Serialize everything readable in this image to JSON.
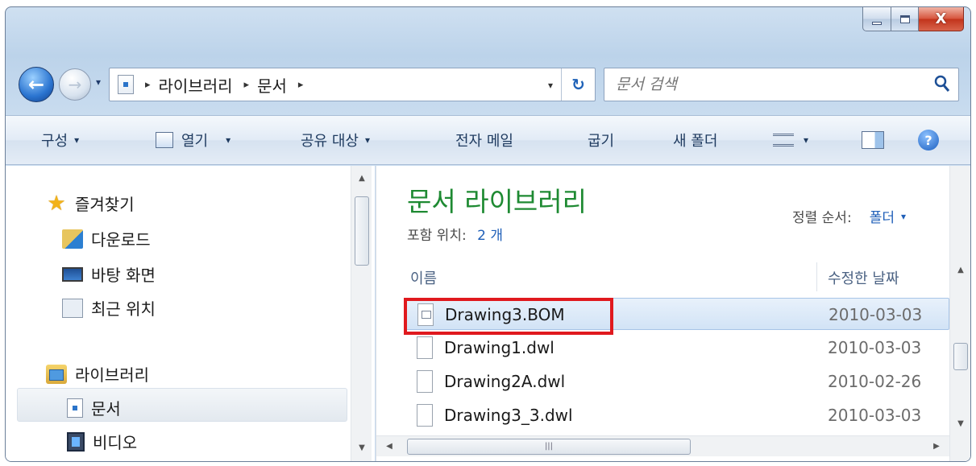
{
  "window": {
    "caption": {
      "minimize_icon": "minimize-icon",
      "maximize_icon": "maximize-icon",
      "close_glyph": "X"
    }
  },
  "address": {
    "crumbs": [
      "라이브러리",
      "문서"
    ],
    "separator": "▸",
    "dropdown": "▾",
    "refresh": "↻"
  },
  "search": {
    "placeholder": "문서 검색",
    "icon": "search-icon"
  },
  "commands": {
    "organize": "구성",
    "open": "열기",
    "share_with": "공유 대상",
    "email": "전자 메일",
    "burn": "굽기",
    "new_folder": "새 폴더",
    "caret": "▾"
  },
  "nav": {
    "favorites": "즐겨찾기",
    "downloads": "다운로드",
    "desktop": "바탕 화면",
    "recent_places": "최근 위치",
    "libraries": "라이브러리",
    "documents": "문서",
    "videos": "비디오"
  },
  "content": {
    "library_title": "문서 라이브러리",
    "includes_label": "포함 위치:",
    "includes_value": "2 개",
    "sort_label": "정렬 순서:",
    "sort_value": "폴더",
    "columns": {
      "name": "이름",
      "date_modified": "수정한 날짜"
    },
    "files": [
      {
        "name": "Drawing3.BOM",
        "date": "2010-03-03 ",
        "selected": true
      },
      {
        "name": "Drawing1.dwl",
        "date": "2010-03-03 ",
        "selected": false
      },
      {
        "name": "Drawing2A.dwl",
        "date": "2010-02-26 ",
        "selected": false
      },
      {
        "name": "Drawing3_3.dwl",
        "date": "2010-03-03 ",
        "selected": false
      }
    ]
  },
  "colors": {
    "title_green": "#1e8a32",
    "link_blue": "#1f5fb8",
    "highlight_red": "#e0191e"
  }
}
